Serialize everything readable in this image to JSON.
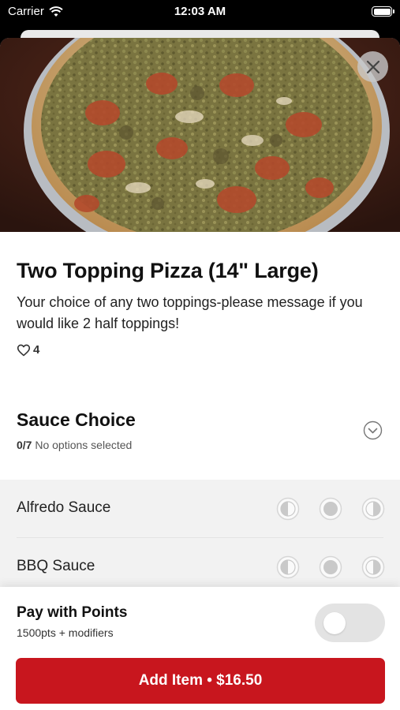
{
  "status_bar": {
    "carrier": "Carrier",
    "time": "12:03 AM"
  },
  "item": {
    "title": "Two Topping Pizza (14\" Large)",
    "description": "Your choice of any two toppings-please message if you would like 2 half toppings!",
    "likes": "4"
  },
  "modifier_group": {
    "title": "Sauce Choice",
    "count": "0/7",
    "status": "No options selected",
    "options": [
      {
        "label": "Alfredo Sauce"
      },
      {
        "label": "BBQ Sauce"
      }
    ]
  },
  "points": {
    "title": "Pay with Points",
    "subtitle": "1500pts + modifiers",
    "enabled": false
  },
  "add_button": {
    "label": "Add Item • $16.50"
  },
  "colors": {
    "accent": "#c8161e",
    "toggle_off": "#e3e3e3",
    "option_bg": "#f2f2f2"
  }
}
